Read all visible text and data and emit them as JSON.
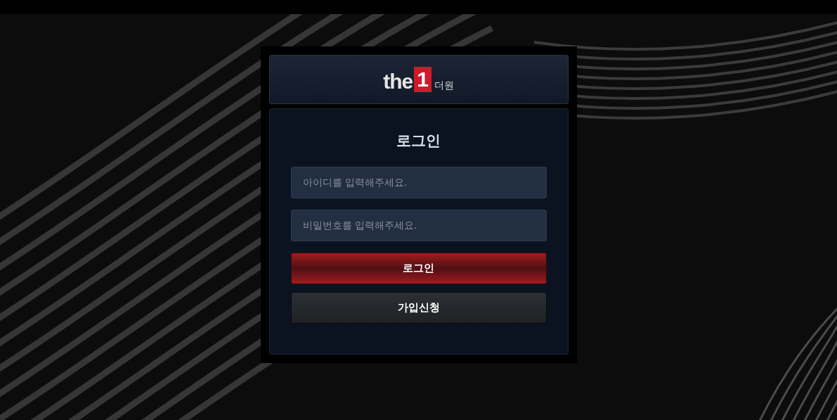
{
  "logo": {
    "wordmark": "the",
    "numeral": "1",
    "korean": "더원"
  },
  "title": "로그인",
  "fields": [
    {
      "placeholder": "아이디를 입력해주세요."
    },
    {
      "placeholder": "비밀번호를 입력해주세요."
    }
  ],
  "buttons": [
    {
      "label": "로그인",
      "kind": "primary"
    },
    {
      "label": "가입신청",
      "kind": "secondary"
    }
  ]
}
